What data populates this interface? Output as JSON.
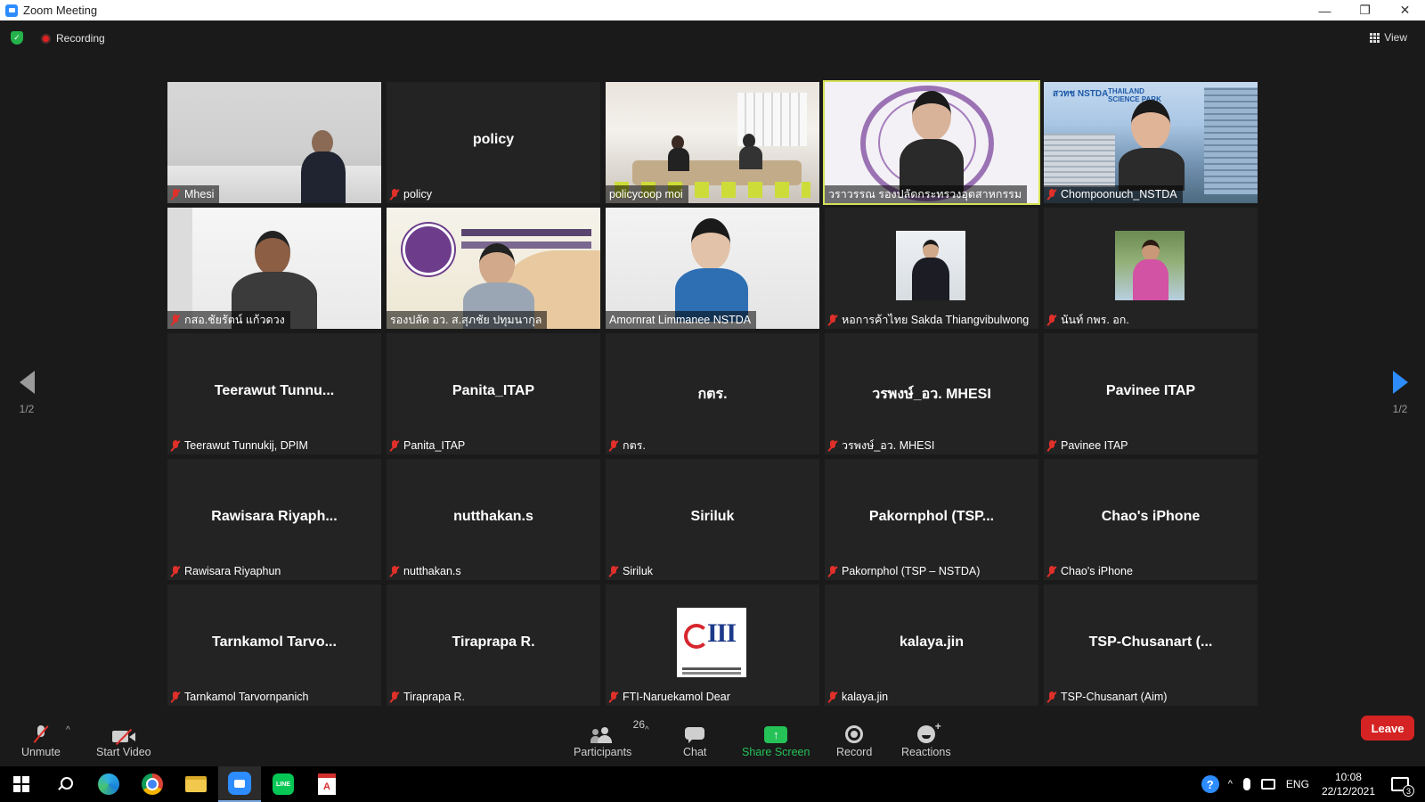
{
  "window": {
    "title": "Zoom Meeting",
    "controls": {
      "minimize": "—",
      "restore": "❐",
      "close": "✕"
    }
  },
  "topbar": {
    "recording_label": "Recording",
    "view_label": "View"
  },
  "gallery": {
    "active_speaker_color": "#d4e157",
    "page_indicator_left": "1/2",
    "page_indicator_right": "1/2",
    "tiles": [
      {
        "name": "Mhesi",
        "muted": true,
        "video": "office"
      },
      {
        "name": "policy",
        "display": "policy",
        "muted": true,
        "video": "none"
      },
      {
        "name": "policycoop moi",
        "muted": false,
        "video": "room"
      },
      {
        "name": "วราวรรณ รองปลัดกระทรวงอุตสาหกรรม",
        "muted": false,
        "video": "seal",
        "active": true
      },
      {
        "name": "Chompoonuch_NSTDA",
        "muted": true,
        "video": "park",
        "logo_text_1": "สวทช NSTDA",
        "logo_text_2": "THAILAND SCIENCE PARK"
      },
      {
        "name": "กสอ.ชัยรัตน์ แก้วดวง",
        "muted": true,
        "video": "white"
      },
      {
        "name": "รองปลัด อว. ส.สุภชัย ปทุมนากุล",
        "muted": false,
        "video": "backdrop"
      },
      {
        "name": "Amornrat Limmanee NSTDA",
        "muted": false,
        "video": "blue"
      },
      {
        "name": "หอการค้าไทย Sakda Thiangvibulwong",
        "muted": true,
        "video": "avatar-suit"
      },
      {
        "name": "นันท์ กพร. อก.",
        "muted": true,
        "video": "avatar-lake"
      },
      {
        "name": "Teerawut Tunnukij, DPIM",
        "display": "Teerawut  Tunnu...",
        "muted": true,
        "video": "none"
      },
      {
        "name": "Panita_ITAP",
        "display": "Panita_ITAP",
        "muted": true,
        "video": "none"
      },
      {
        "name": "กตร.",
        "display": "กตร.",
        "muted": true,
        "video": "none"
      },
      {
        "name": "วรพงษ์_อว. MHESI",
        "display": "วรพงษ์_อว. MHESI",
        "muted": true,
        "video": "none"
      },
      {
        "name": "Pavinee ITAP",
        "display": "Pavinee ITAP",
        "muted": true,
        "video": "none"
      },
      {
        "name": "Rawisara Riyaphun",
        "display": "Rawisara  Riyaph...",
        "muted": true,
        "video": "none"
      },
      {
        "name": "nutthakan.s",
        "display": "nutthakan.s",
        "muted": true,
        "video": "none"
      },
      {
        "name": "Siriluk",
        "display": "Siriluk",
        "muted": true,
        "video": "none"
      },
      {
        "name": "Pakornphol (TSP – NSTDA)",
        "display": "Pakornphol  (TSP...",
        "muted": true,
        "video": "none"
      },
      {
        "name": "Chao's iPhone",
        "display": "Chao's iPhone",
        "muted": true,
        "video": "none"
      },
      {
        "name": "Tarnkamol Tarvornpanich",
        "display": "Tarnkamol  Tarvo...",
        "muted": true,
        "video": "none"
      },
      {
        "name": "Tiraprapa R.",
        "display": "Tiraprapa R.",
        "muted": true,
        "video": "none"
      },
      {
        "name": "FTI-Naruekamol Dear",
        "muted": true,
        "video": "avatar-iii"
      },
      {
        "name": "kalaya.jin",
        "display": "kalaya.jin",
        "muted": true,
        "video": "none"
      },
      {
        "name": "TSP-Chusanart (Aim)",
        "display": "TSP-Chusanart  (...",
        "muted": true,
        "video": "none"
      }
    ]
  },
  "toolbar": {
    "unmute_label": "Unmute",
    "start_video_label": "Start Video",
    "participants_label": "Participants",
    "participants_count": "26",
    "chat_label": "Chat",
    "share_screen_label": "Share Screen",
    "record_label": "Record",
    "reactions_label": "Reactions",
    "leave_label": "Leave",
    "share_color": "#24c257",
    "leave_color": "#d52323",
    "caret": "^"
  },
  "taskbar": {
    "line_label": "LINE",
    "pdf_label": "A",
    "help_label": "?",
    "tray_chevron": "^",
    "language": "ENG",
    "time": "10:08",
    "date": "22/12/2021",
    "notification_count": "3"
  }
}
